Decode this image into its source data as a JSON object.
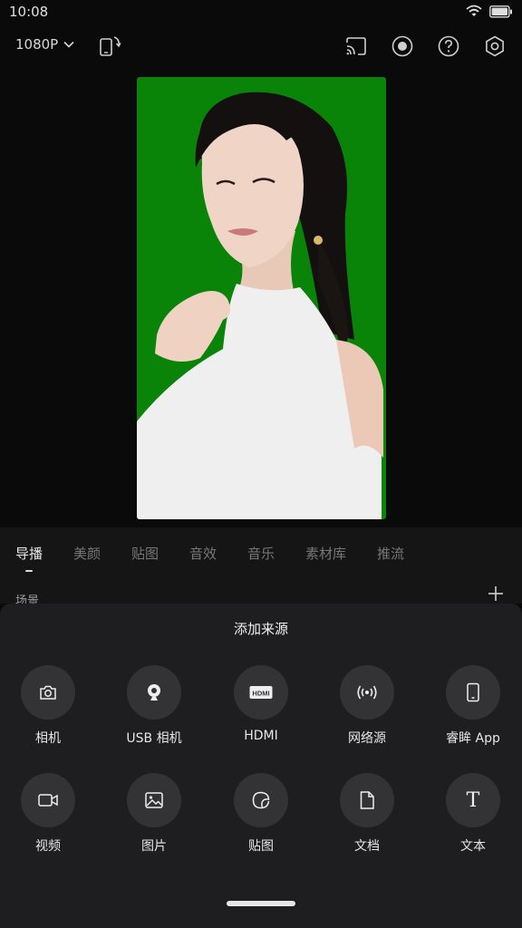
{
  "status": {
    "time": "10:08"
  },
  "header": {
    "resolution": "1080P"
  },
  "tabs": [
    {
      "label": "导播",
      "active": true
    },
    {
      "label": "美颜"
    },
    {
      "label": "贴图"
    },
    {
      "label": "音效"
    },
    {
      "label": "音乐"
    },
    {
      "label": "素材库"
    },
    {
      "label": "推流"
    }
  ],
  "scene": {
    "label": "场景"
  },
  "sheet": {
    "title": "添加来源",
    "items": [
      {
        "label": "相机",
        "icon": "camera-icon"
      },
      {
        "label": "USB 相机",
        "icon": "webcam-icon"
      },
      {
        "label": "HDMI",
        "icon": "hdmi-icon",
        "badge": "HDMI"
      },
      {
        "label": "网络源",
        "icon": "broadcast-icon"
      },
      {
        "label": "睿眸 App",
        "icon": "phone-icon"
      },
      {
        "label": "视频",
        "icon": "video-icon"
      },
      {
        "label": "图片",
        "icon": "image-icon"
      },
      {
        "label": "贴图",
        "icon": "sticker-icon"
      },
      {
        "label": "文档",
        "icon": "document-icon"
      },
      {
        "label": "文本",
        "icon": "text-icon",
        "glyph": "T"
      }
    ]
  },
  "colors": {
    "canvas": "#098408",
    "sheet": "#1e1e20",
    "circle": "#333336"
  }
}
